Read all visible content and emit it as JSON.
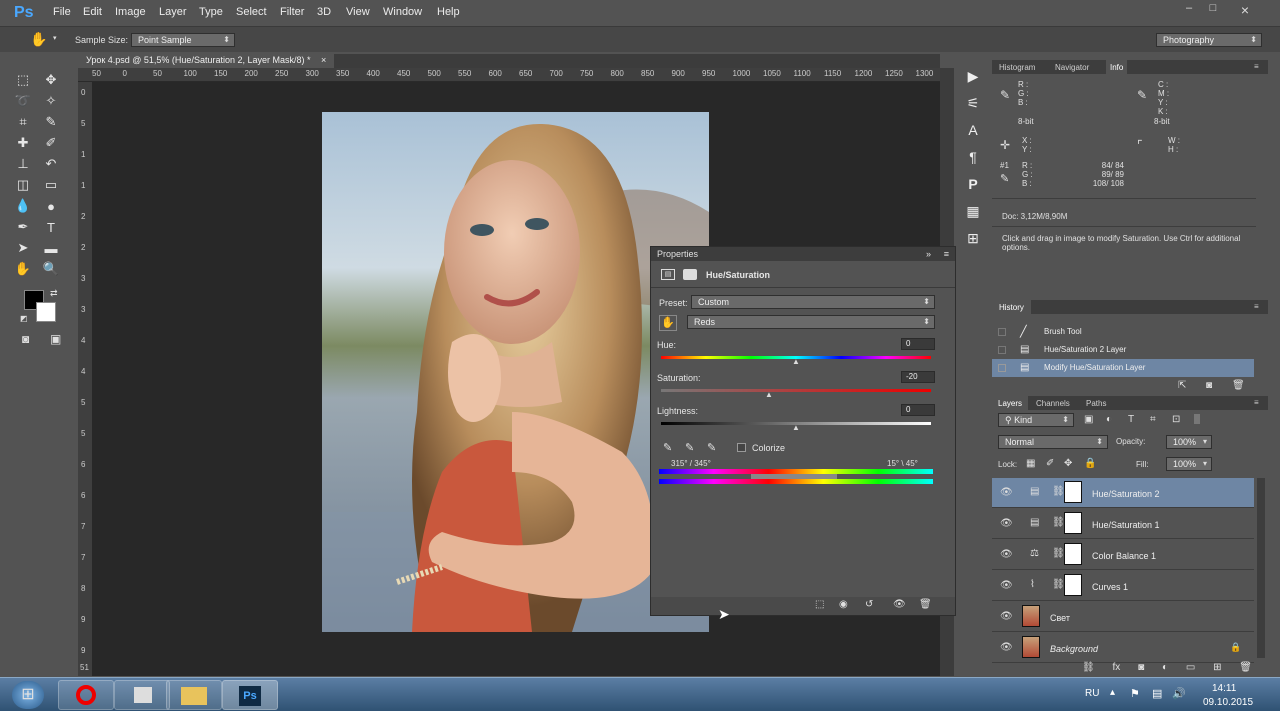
{
  "app": {
    "logo": "Ps"
  },
  "menu": [
    "File",
    "Edit",
    "Image",
    "Layer",
    "Type",
    "Select",
    "Filter",
    "3D",
    "View",
    "Window",
    "Help"
  ],
  "window_controls": {
    "minimize": "–",
    "maximize": "□",
    "close": "×"
  },
  "options_bar": {
    "sample_size_label": "Sample Size:",
    "sample_size_value": "Point Sample",
    "workspace": "Photography"
  },
  "document": {
    "tab_title": "Урок 4.psd @ 51,5% (Hue/Saturation 2, Layer Mask/8) *",
    "zoom_footer": "51"
  },
  "ruler_h": [
    "50",
    "0",
    "50",
    "100",
    "150",
    "200",
    "250",
    "300",
    "350",
    "400",
    "450",
    "500",
    "550",
    "600",
    "650",
    "700",
    "750",
    "800",
    "850",
    "900",
    "950",
    "1000",
    "1050",
    "1100",
    "1150",
    "1200",
    "1250",
    "1300"
  ],
  "ruler_v": [
    "0",
    "5",
    "1",
    "1",
    "2",
    "2",
    "3",
    "3",
    "4",
    "4",
    "5",
    "5",
    "6",
    "6",
    "7",
    "7",
    "8",
    "9",
    "9"
  ],
  "properties": {
    "panel_title": "Properties",
    "adjustment": "Hue/Saturation",
    "preset_label": "Preset:",
    "preset_value": "Custom",
    "channel_value": "Reds",
    "hue_label": "Hue:",
    "hue_value": "0",
    "saturation_label": "Saturation:",
    "saturation_value": "-20",
    "lightness_label": "Lightness:",
    "lightness_value": "0",
    "colorize_label": "Colorize",
    "range_left": "315° / 345°",
    "range_right": "15° \\ 45°"
  },
  "info_panel": {
    "tabs": [
      "Histogram",
      "Navigator",
      "Info"
    ],
    "active_tab": "Info",
    "rgb_labels": [
      "R :",
      "G :",
      "B :"
    ],
    "bit_left": "8-bit",
    "cmyk_labels": [
      "C :",
      "M :",
      "Y :",
      "K :"
    ],
    "bit_right": "8-bit",
    "xy_labels": [
      "X :",
      "Y :"
    ],
    "wh_labels": [
      "W :",
      "H :"
    ],
    "sample_id": "#1",
    "sample_rows": [
      {
        "label": "R :",
        "value": "84/  84"
      },
      {
        "label": "G :",
        "value": "89/  89"
      },
      {
        "label": "B :",
        "value": "108/ 108"
      }
    ],
    "doc": "Doc: 3,12M/8,90M",
    "hint": "Click and drag in image to modify Saturation. Use Ctrl for additional options."
  },
  "history": {
    "title": "History",
    "items": [
      {
        "label": "Brush Tool",
        "icon": "brush-icon"
      },
      {
        "label": "Hue/Saturation 2 Layer",
        "icon": "document-icon"
      },
      {
        "label": "Modify Hue/Saturation Layer",
        "icon": "document-icon",
        "selected": true
      }
    ]
  },
  "layers_panel": {
    "tabs": [
      "Layers",
      "Channels",
      "Paths"
    ],
    "active_tab": "Layers",
    "filter": "Kind",
    "blend_mode": "Normal",
    "opacity_label": "Opacity:",
    "opacity_value": "100%",
    "lock_label": "Lock:",
    "fill_label": "Fill:",
    "fill_value": "100%",
    "layers": [
      {
        "name": "Hue/Saturation 2",
        "type": "adjustment",
        "icon": "hue-saturation-icon",
        "selected": true
      },
      {
        "name": "Hue/Saturation 1",
        "type": "adjustment",
        "icon": "hue-saturation-icon"
      },
      {
        "name": "Color Balance 1",
        "type": "adjustment",
        "icon": "color-balance-icon"
      },
      {
        "name": "Curves 1",
        "type": "adjustment",
        "icon": "curves-icon"
      },
      {
        "name": "Свет",
        "type": "image",
        "icon": "photo-thumb"
      },
      {
        "name": "Background",
        "type": "image",
        "icon": "photo-thumb",
        "locked": true
      }
    ]
  },
  "taskbar": {
    "language": "RU",
    "time": "14:11",
    "date": "09.10.2015"
  },
  "colors": {
    "accent": "#4aa8ff",
    "selected_row": "#6e86a4",
    "panel_bg": "#535353",
    "dark_bg": "#282828"
  }
}
